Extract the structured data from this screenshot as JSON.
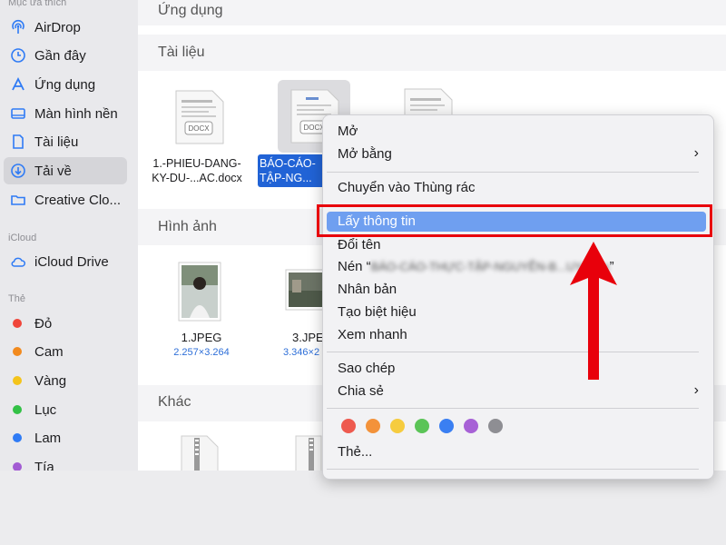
{
  "sidebar": {
    "favorites_header": "Mục ưa thích",
    "items": [
      {
        "label": "AirDrop",
        "icon": "airdrop-icon"
      },
      {
        "label": "Gần đây",
        "icon": "clock-icon"
      },
      {
        "label": "Ứng dụng",
        "icon": "applications-icon"
      },
      {
        "label": "Màn hình nền",
        "icon": "desktop-icon"
      },
      {
        "label": "Tài liệu",
        "icon": "document-icon"
      },
      {
        "label": "Tải về",
        "icon": "download-icon",
        "selected": true
      },
      {
        "label": "Creative Clo...",
        "icon": "folder-icon"
      }
    ],
    "icloud_header": "iCloud",
    "icloud_items": [
      {
        "label": "iCloud Drive",
        "icon": "cloud-icon"
      }
    ],
    "tags_header": "Thẻ",
    "tags": [
      {
        "label": "Đỏ",
        "color": "#f0453a"
      },
      {
        "label": "Cam",
        "color": "#f28a1e"
      },
      {
        "label": "Vàng",
        "color": "#f4c41b"
      },
      {
        "label": "Lục",
        "color": "#33c146"
      },
      {
        "label": "Lam",
        "color": "#2f7bf5"
      },
      {
        "label": "Tía",
        "color": "#a25bd3"
      }
    ]
  },
  "main": {
    "top_section": "Ứng dụng",
    "documents_section": "Tài liệu",
    "documents": [
      {
        "line1": "1.-PHIEU-DANG-",
        "line2": "KY-DU-...AC.docx",
        "badge": "DOCX"
      },
      {
        "line1": "BÁO-CÁO-",
        "line2": "TẬP-NG...",
        "badge": "DOCX",
        "selected": true
      }
    ],
    "images_section": "Hình ảnh",
    "images": [
      {
        "name": "1.JPEG",
        "dims": "2.257×3.264"
      },
      {
        "name": "3.JPE",
        "dims": "3.346×2"
      }
    ],
    "other_section": "Khác"
  },
  "context_menu": {
    "items": [
      {
        "label": "Mở"
      },
      {
        "label": "Mở bằng",
        "submenu": true
      },
      {
        "label": "Chuyển vào Thùng rác"
      },
      {
        "label": "Lấy thông tin",
        "highlighted": true
      },
      {
        "label": "Đổi tên"
      },
      {
        "label": "Nén “",
        "blurred": "BÁO-CÁO-THỰC-TẬP-NGUYỄN-B...UY.docx",
        "suffix": "”"
      },
      {
        "label": "Nhân bản"
      },
      {
        "label": "Tạo biệt hiệu"
      },
      {
        "label": "Xem nhanh"
      },
      {
        "label": "Sao chép"
      },
      {
        "label": "Chia sẻ",
        "submenu": true
      },
      {
        "label": "Thẻ..."
      }
    ],
    "tag_colors": [
      "#ee5a4f",
      "#f3923a",
      "#f6cc3f",
      "#5bc457",
      "#3a7ff2",
      "#a761d6",
      "#8e8e93"
    ],
    "submenu_glyph": "›"
  },
  "annotation": {
    "box_color": "#e8000b",
    "arrow_color": "#e8000b"
  }
}
